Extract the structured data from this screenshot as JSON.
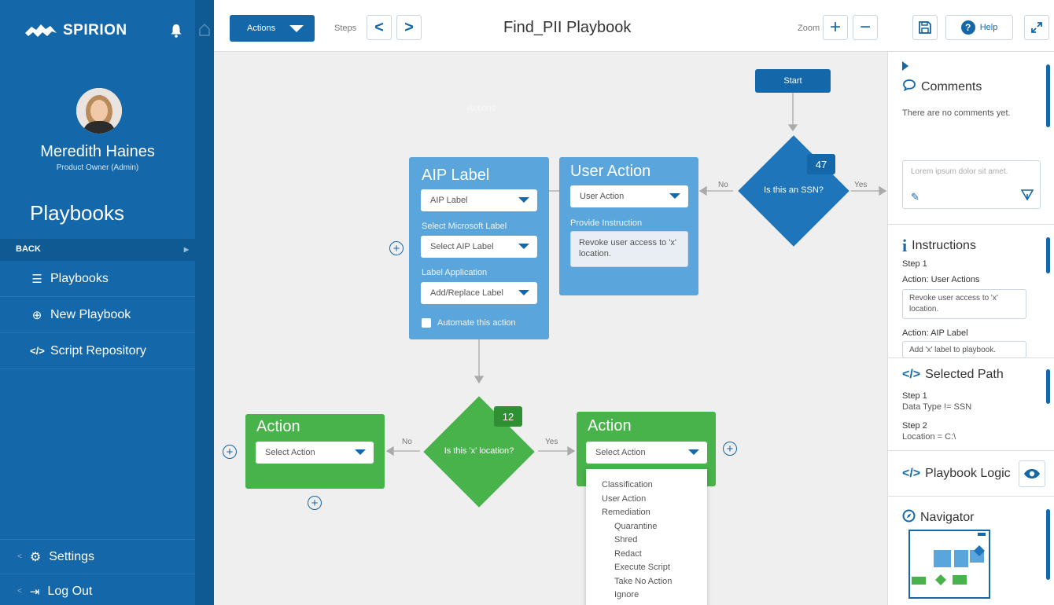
{
  "sidebar": {
    "logo_text": "SPIRION",
    "user_name": "Meredith Haines",
    "user_role": "Product Owner (Admin)",
    "section_title": "Playbooks",
    "back_label": "BACK",
    "items": [
      {
        "label": "Playbooks",
        "icon": "list-icon"
      },
      {
        "label": "New Playbook",
        "icon": "add-circle-icon"
      },
      {
        "label": "Script Repository",
        "icon": "code-icon"
      }
    ],
    "settings_label": "Settings",
    "logout_label": "Log Out"
  },
  "toolbar": {
    "actions_label": "Actions",
    "steps_label": "Steps",
    "title": "Find_PII Playbook",
    "zoom_label": "Zoom",
    "help_label": "Help"
  },
  "canvas": {
    "start_label": "Start",
    "ghost_label": "Actions",
    "diamond_ssn": {
      "text": "Is this an SSN?",
      "count": "47",
      "no": "No",
      "yes": "Yes"
    },
    "diamond_loc": {
      "text": "Is this 'x' location?",
      "count": "12",
      "no": "No",
      "yes": "Yes"
    },
    "aip_card": {
      "title": "AIP Label",
      "select1": "AIP Label",
      "ms_label": "Select Microsoft Label",
      "select2": "Select AIP Label",
      "app_label": "Label Application",
      "select3": "Add/Replace Label",
      "automate": "Automate this action"
    },
    "user_card": {
      "title": "User Action",
      "select": "User Action",
      "instr_label": "Provide Instruction",
      "instr_text": "Revoke user access to 'x' location."
    },
    "action_left": {
      "title": "Action",
      "select": "Select Action"
    },
    "action_right": {
      "title": "Action",
      "select": "Select Action"
    },
    "dropdown": {
      "items": [
        "Classification",
        "User Action",
        "Remediation"
      ],
      "sub_items": [
        "Quarantine",
        "Shred",
        "Redact",
        "Execute Script",
        "Take No Action",
        "Ignore"
      ]
    }
  },
  "right_panel": {
    "comments": {
      "title": "Comments",
      "empty": "There are no comments yet.",
      "placeholder": "Lorem ipsum dolor sit amet."
    },
    "instructions": {
      "title": "Instructions",
      "step": "Step 1",
      "a1_label": "Action: User Actions",
      "a1_text": "Revoke user access to 'x' location.",
      "a2_label": "Action: AIP Label",
      "a2_text": "Add 'x' label to playbook."
    },
    "selected_path": {
      "title": "Selected Path",
      "s1": "Step 1",
      "s1v": "Data Type != SSN",
      "s2": "Step 2",
      "s2v": "Location = C:\\"
    },
    "playbook_logic": {
      "title": "Playbook Logic"
    },
    "navigator": {
      "title": "Navigator"
    }
  },
  "colors": {
    "primary": "#1467a8",
    "light_blue": "#5aa5dc",
    "green": "#48b24b",
    "dark_green": "#2f8f33"
  }
}
